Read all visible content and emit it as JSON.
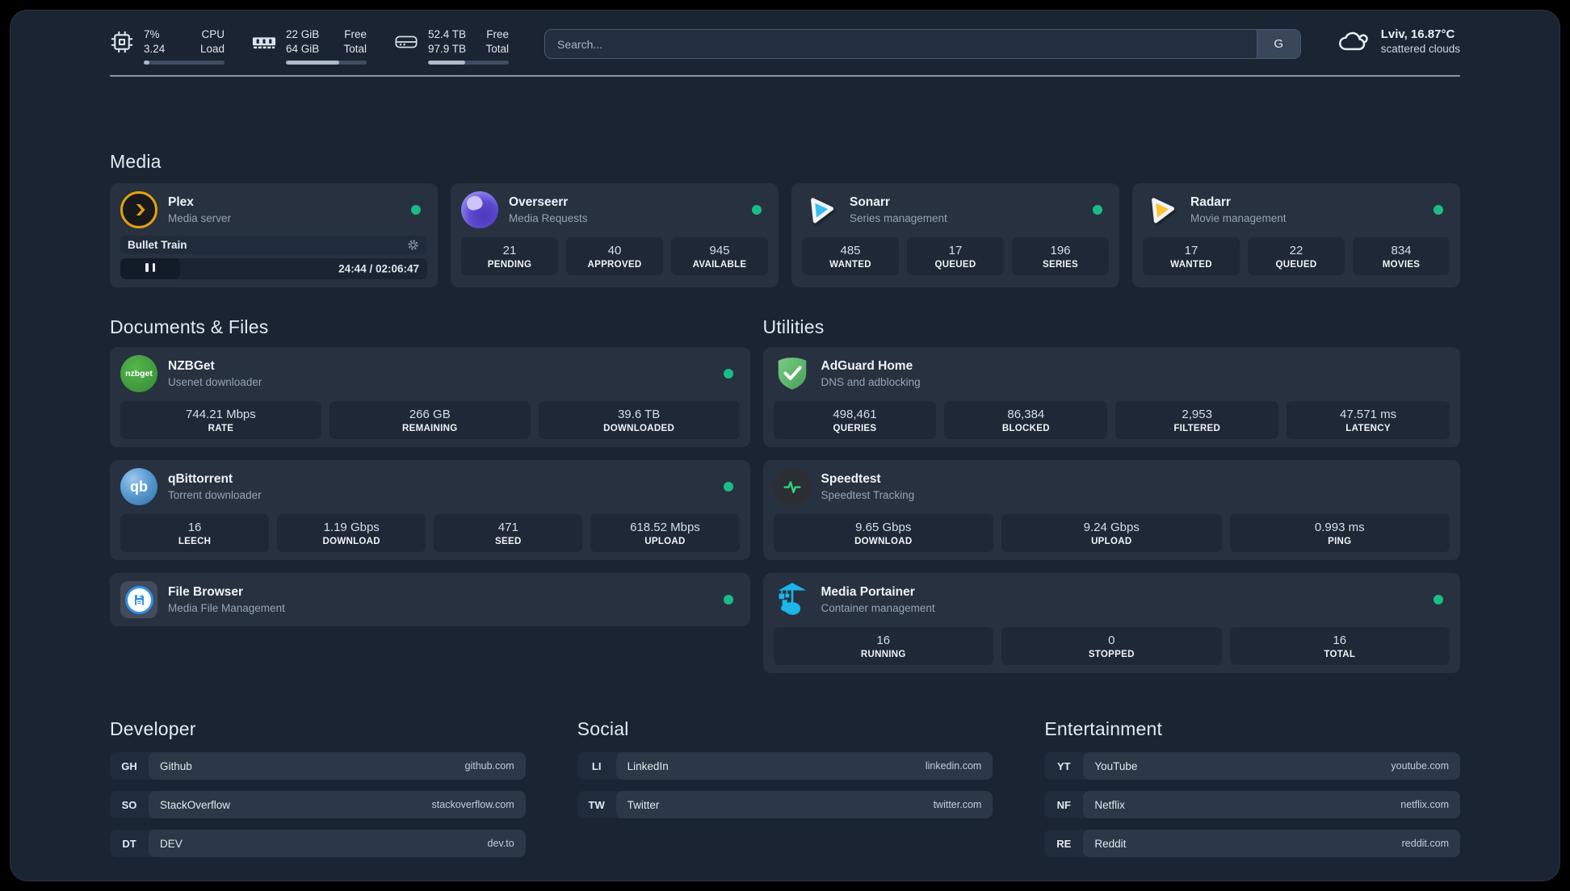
{
  "colors": {
    "bg": "#1a2433",
    "card": "#273140",
    "inner": "#1e2836",
    "status_green": "#1abc86",
    "plex_gold": "#e5a00d",
    "sonarr_blue": "#38bdf2",
    "radarr_yellow": "#ffc230",
    "nzbget_green": "#3da63f",
    "qbittorrent_blue": "#4f93cf",
    "adguard_green": "#5cb76a",
    "speedtest_green": "#2bd680",
    "portainer_blue": "#1ab6ea",
    "filebrowser_blue": "#2f8fe8",
    "overseerr_purple": "#7a68e8"
  },
  "topbar": {
    "cpu": {
      "values": [
        "7%",
        "3.24"
      ],
      "labels": [
        "CPU",
        "Load"
      ],
      "progress": 7
    },
    "memory": {
      "values": [
        "22 GiB",
        "64 GiB"
      ],
      "labels": [
        "Free",
        "Total"
      ],
      "progress": 66
    },
    "disk": {
      "values": [
        "52.4 TB",
        "97.9 TB"
      ],
      "labels": [
        "Free",
        "Total"
      ],
      "progress": 46
    },
    "search": {
      "placeholder": "Search...",
      "engine_button": "G"
    },
    "weather": {
      "location_temperature": "Lviv, 16.87°C",
      "condition": "scattered clouds"
    }
  },
  "media": {
    "header": "Media",
    "plex": {
      "title": "Plex",
      "subtitle": "Media server",
      "online": true,
      "now_playing": "Bullet Train",
      "elapsed_total": "24:44 / 02:06:47",
      "progress_percent": 19.5
    },
    "overseerr": {
      "title": "Overseerr",
      "subtitle": "Media Requests",
      "online": true,
      "stats": [
        {
          "value": "21",
          "label": "PENDING"
        },
        {
          "value": "40",
          "label": "APPROVED"
        },
        {
          "value": "945",
          "label": "AVAILABLE"
        }
      ]
    },
    "sonarr": {
      "title": "Sonarr",
      "subtitle": "Series management",
      "online": true,
      "stats": [
        {
          "value": "485",
          "label": "WANTED"
        },
        {
          "value": "17",
          "label": "QUEUED"
        },
        {
          "value": "196",
          "label": "SERIES"
        }
      ]
    },
    "radarr": {
      "title": "Radarr",
      "subtitle": "Movie management",
      "online": true,
      "stats": [
        {
          "value": "17",
          "label": "WANTED"
        },
        {
          "value": "22",
          "label": "QUEUED"
        },
        {
          "value": "834",
          "label": "MOVIES"
        }
      ]
    }
  },
  "documents": {
    "header": "Documents & Files",
    "nzbget": {
      "title": "NZBGet",
      "subtitle": "Usenet downloader",
      "online": true,
      "monogram": "nzbget",
      "stats": [
        {
          "value": "744.21 Mbps",
          "label": "RATE"
        },
        {
          "value": "266 GB",
          "label": "REMAINING"
        },
        {
          "value": "39.6 TB",
          "label": "DOWNLOADED"
        }
      ]
    },
    "qbittorrent": {
      "title": "qBittorrent",
      "subtitle": "Torrent downloader",
      "online": true,
      "monogram": "qb",
      "stats": [
        {
          "value": "16",
          "label": "LEECH"
        },
        {
          "value": "1.19 Gbps",
          "label": "DOWNLOAD"
        },
        {
          "value": "471",
          "label": "SEED"
        },
        {
          "value": "618.52 Mbps",
          "label": "UPLOAD"
        }
      ]
    },
    "filebrowser": {
      "title": "File Browser",
      "subtitle": "Media File Management",
      "online": true
    }
  },
  "utilities": {
    "header": "Utilities",
    "adguard": {
      "title": "AdGuard Home",
      "subtitle": "DNS and adblocking",
      "online": false,
      "stats": [
        {
          "value": "498,461",
          "label": "QUERIES"
        },
        {
          "value": "86,384",
          "label": "BLOCKED"
        },
        {
          "value": "2,953",
          "label": "FILTERED"
        },
        {
          "value": "47.571 ms",
          "label": "LATENCY"
        }
      ]
    },
    "speedtest": {
      "title": "Speedtest",
      "subtitle": "Speedtest Tracking",
      "online": false,
      "stats": [
        {
          "value": "9.65 Gbps",
          "label": "DOWNLOAD"
        },
        {
          "value": "9.24 Gbps",
          "label": "UPLOAD"
        },
        {
          "value": "0.993 ms",
          "label": "PING"
        }
      ]
    },
    "portainer": {
      "title": "Media Portainer",
      "subtitle": "Container management",
      "online": true,
      "stats": [
        {
          "value": "16",
          "label": "RUNNING"
        },
        {
          "value": "0",
          "label": "STOPPED"
        },
        {
          "value": "16",
          "label": "TOTAL"
        }
      ]
    }
  },
  "bookmarks": {
    "developer": {
      "header": "Developer",
      "items": [
        {
          "abbr": "GH",
          "name": "Github",
          "url": "github.com"
        },
        {
          "abbr": "SO",
          "name": "StackOverflow",
          "url": "stackoverflow.com"
        },
        {
          "abbr": "DT",
          "name": "DEV",
          "url": "dev.to"
        }
      ]
    },
    "social": {
      "header": "Social",
      "items": [
        {
          "abbr": "LI",
          "name": "LinkedIn",
          "url": "linkedin.com"
        },
        {
          "abbr": "TW",
          "name": "Twitter",
          "url": "twitter.com"
        }
      ]
    },
    "entertainment": {
      "header": "Entertainment",
      "items": [
        {
          "abbr": "YT",
          "name": "YouTube",
          "url": "youtube.com"
        },
        {
          "abbr": "NF",
          "name": "Netflix",
          "url": "netflix.com"
        },
        {
          "abbr": "RE",
          "name": "Reddit",
          "url": "reddit.com"
        }
      ]
    }
  }
}
